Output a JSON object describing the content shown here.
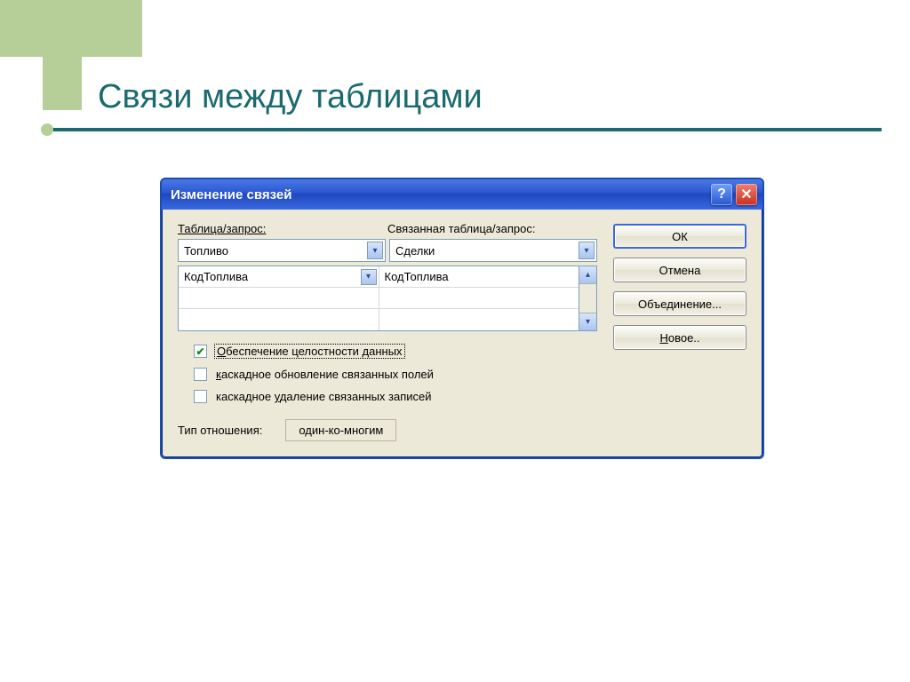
{
  "slide": {
    "title": "Связи между таблицами"
  },
  "dialog": {
    "title": "Изменение связей",
    "labels": {
      "table_query": "Таблица/запрос:",
      "related_table_query": "Связанная таблица/запрос:"
    },
    "combo": {
      "left": "Топливо",
      "right": "Сделки"
    },
    "grid": {
      "rows": [
        {
          "left": "КодТоплива",
          "right": "КодТоплива"
        },
        {
          "left": "",
          "right": ""
        },
        {
          "left": "",
          "right": ""
        }
      ]
    },
    "checks": {
      "integrity_prefix": "О",
      "integrity_rest": "беспечение целостности данных",
      "cascade_update_prefix": "к",
      "cascade_update_rest": "аскадное обновление связанных полей",
      "cascade_delete_prefix": "каскадное ",
      "cascade_delete_u": "у",
      "cascade_delete_rest": "даление связанных записей"
    },
    "relation": {
      "label": "Тип отношения:",
      "value": "один-ко-многим"
    },
    "buttons": {
      "ok": "ОК",
      "cancel": "Отмена",
      "join": "Объединение...",
      "new_prefix": "Н",
      "new_rest": "овое.."
    }
  }
}
